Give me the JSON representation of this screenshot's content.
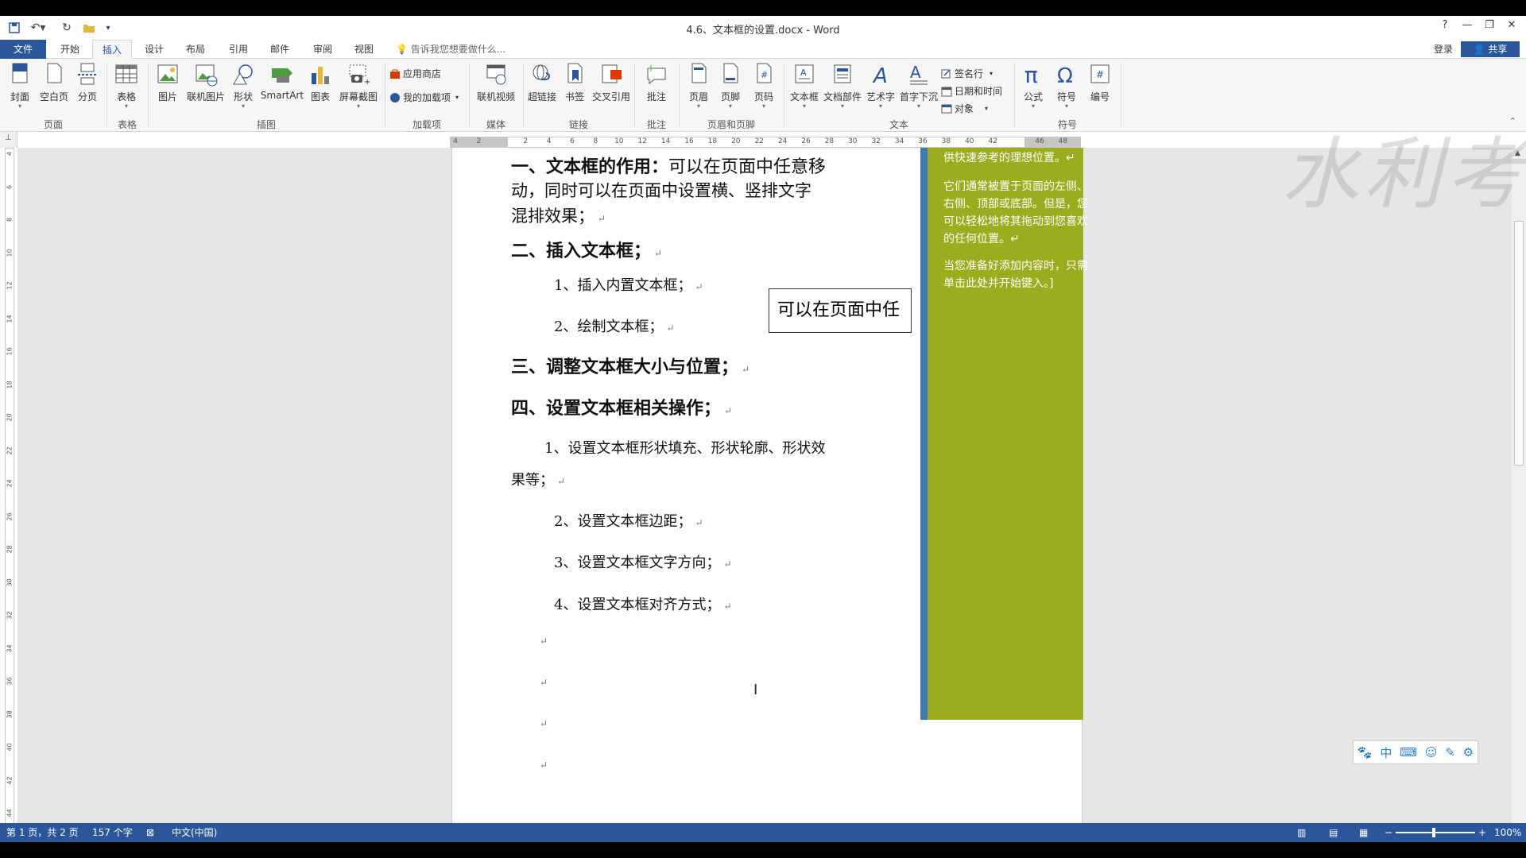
{
  "titlebar": {
    "title": "4.6、文本框的设置.docx - Word",
    "win_buttons": [
      "?",
      "—",
      "❐",
      "✕"
    ]
  },
  "tabs": {
    "file": "文件",
    "items": [
      "开始",
      "插入",
      "设计",
      "布局",
      "引用",
      "邮件",
      "审阅",
      "视图"
    ],
    "active": "插入",
    "tellme": "告诉我您想要做什么...",
    "login": "登录",
    "share": "共享"
  },
  "ribbon": {
    "buttons": [
      {
        "label": "封面",
        "icon": "cover-page-icon"
      },
      {
        "label": "空白页",
        "icon": "blank-page-icon"
      },
      {
        "label": "分页",
        "icon": "page-break-icon"
      },
      {
        "label": "表格",
        "icon": "table-icon"
      },
      {
        "label": "图片",
        "icon": "picture-icon"
      },
      {
        "label": "联机图片",
        "icon": "online-picture-icon"
      },
      {
        "label": "形状",
        "icon": "shapes-icon"
      },
      {
        "label": "SmartArt",
        "icon": "smartart-icon"
      },
      {
        "label": "图表",
        "icon": "chart-icon"
      },
      {
        "label": "屏幕截图",
        "icon": "screenshot-icon"
      },
      {
        "label": "联机视频",
        "icon": "online-video-icon"
      },
      {
        "label": "超链接",
        "icon": "hyperlink-icon"
      },
      {
        "label": "书签",
        "icon": "bookmark-icon"
      },
      {
        "label": "交叉引用",
        "icon": "cross-reference-icon"
      },
      {
        "label": "批注",
        "icon": "comment-icon"
      },
      {
        "label": "页眉",
        "icon": "header-icon"
      },
      {
        "label": "页脚",
        "icon": "footer-icon"
      },
      {
        "label": "页码",
        "icon": "page-number-icon"
      },
      {
        "label": "文本框",
        "icon": "text-box-icon"
      },
      {
        "label": "文档部件",
        "icon": "quick-parts-icon"
      },
      {
        "label": "艺术字",
        "icon": "wordart-icon"
      },
      {
        "label": "首字下沉",
        "icon": "drop-cap-icon"
      },
      {
        "label": "公式",
        "icon": "equation-icon"
      },
      {
        "label": "符号",
        "icon": "symbol-icon"
      },
      {
        "label": "编号",
        "icon": "number-icon"
      }
    ],
    "small_buttons": {
      "store": "应用商店",
      "my_addins": "我的加载项",
      "signature": "签名行",
      "datetime": "日期和时间",
      "object": "对象"
    },
    "groups": [
      "页面",
      "表格",
      "插图",
      "加载项",
      "媒体",
      "链接",
      "批注",
      "页眉和页脚",
      "文本",
      "符号"
    ]
  },
  "ruler": {
    "h_numbers": [
      "4",
      "2",
      "",
      "2",
      "4",
      "6",
      "8",
      "10",
      "12",
      "14",
      "16",
      "18",
      "20",
      "22",
      "24",
      "26",
      "28",
      "30",
      "32",
      "34",
      "36",
      "38",
      "40",
      "42",
      "",
      "46",
      "48"
    ],
    "v_numbers": [
      "4",
      "6",
      "8",
      "10",
      "12",
      "14",
      "16",
      "18",
      "20",
      "22",
      "24",
      "26",
      "28",
      "30",
      "32",
      "34",
      "36",
      "38",
      "40",
      "42",
      "44"
    ]
  },
  "document": {
    "para_mark": "↵",
    "lines": [
      {
        "text": "一、文本框的作用：",
        "rest": "可以在页面中任意移"
      },
      {
        "text": "动，同时可以在页面中设置横、竖排文字"
      },
      {
        "text": "混排效果；"
      },
      {
        "text": "二、插入文本框；"
      },
      {
        "text": "1、插入内置文本框；"
      },
      {
        "text": "2、绘制文本框；"
      },
      {
        "text": "三、调整文本框大小与位置；"
      },
      {
        "text": "四、设置文本框相关操作；"
      },
      {
        "text": "1、设置文本框形状填充、形状轮廓、形状效"
      },
      {
        "text": "果等；"
      },
      {
        "text": "2、设置文本框边距；"
      },
      {
        "text": "3、设置文本框文字方向；"
      },
      {
        "text": "4、设置文本框对齐方式；"
      }
    ],
    "textbox_text": "可以在页面中任",
    "sidebar": [
      "供快速参考的理想位置。",
      "它们通常被置于页面的左侧、右侧、顶部或底部。但是，您可以轻松地将其拖动到您喜欢的任何位置。",
      "当您准备好添加内容时，只需单击此处并开始键入。"
    ],
    "sidebar_marks": [
      "↵",
      "↵",
      "]"
    ]
  },
  "ime": [
    "🐾",
    "中",
    "⌨",
    "☺",
    "✎",
    "⚙"
  ],
  "watermark": "水利考资",
  "statusbar": {
    "page": "第 1 页，共 2 页",
    "words": "157 个字",
    "language": "中文(中国)",
    "zoom": "100%"
  },
  "colors": {
    "accent": "#2b579a",
    "sidebar_fill": "#9cac1f",
    "sidebar_border": "#3f7bb3"
  }
}
